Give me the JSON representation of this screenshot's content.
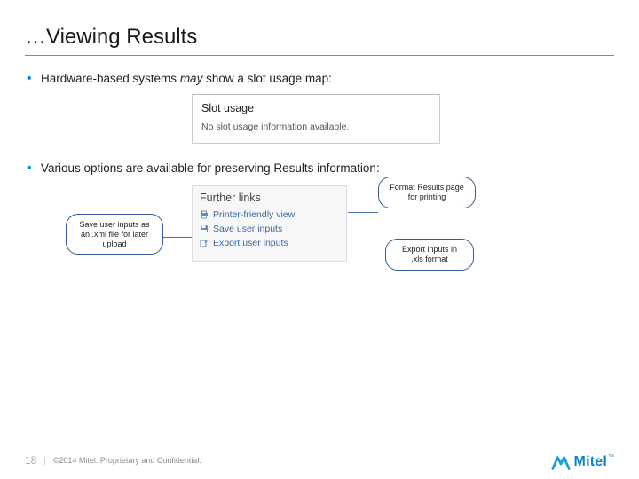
{
  "title": "…Viewing Results",
  "bullets": {
    "hardware_pre": "Hardware-based systems ",
    "hardware_may": "may",
    "hardware_post": " show a slot usage map:",
    "options": "Various options are available for preserving Results information:"
  },
  "slotusage": {
    "heading": "Slot usage",
    "message": "No slot usage information available."
  },
  "furtherlinks": {
    "heading": "Further links",
    "items": [
      "Printer-friendly view",
      "Save user inputs",
      "Export user inputs"
    ]
  },
  "callouts": {
    "format": "Format Results page for printing",
    "save_xml": "Save user inputs as an .xml file for later upload",
    "export_xls": "Export inputs in .xls format"
  },
  "footer": {
    "page": "18",
    "copyright": "©2014 Mitel. Proprietary and Confidential."
  },
  "logo": {
    "text": "Mitel",
    "tm": "™"
  }
}
